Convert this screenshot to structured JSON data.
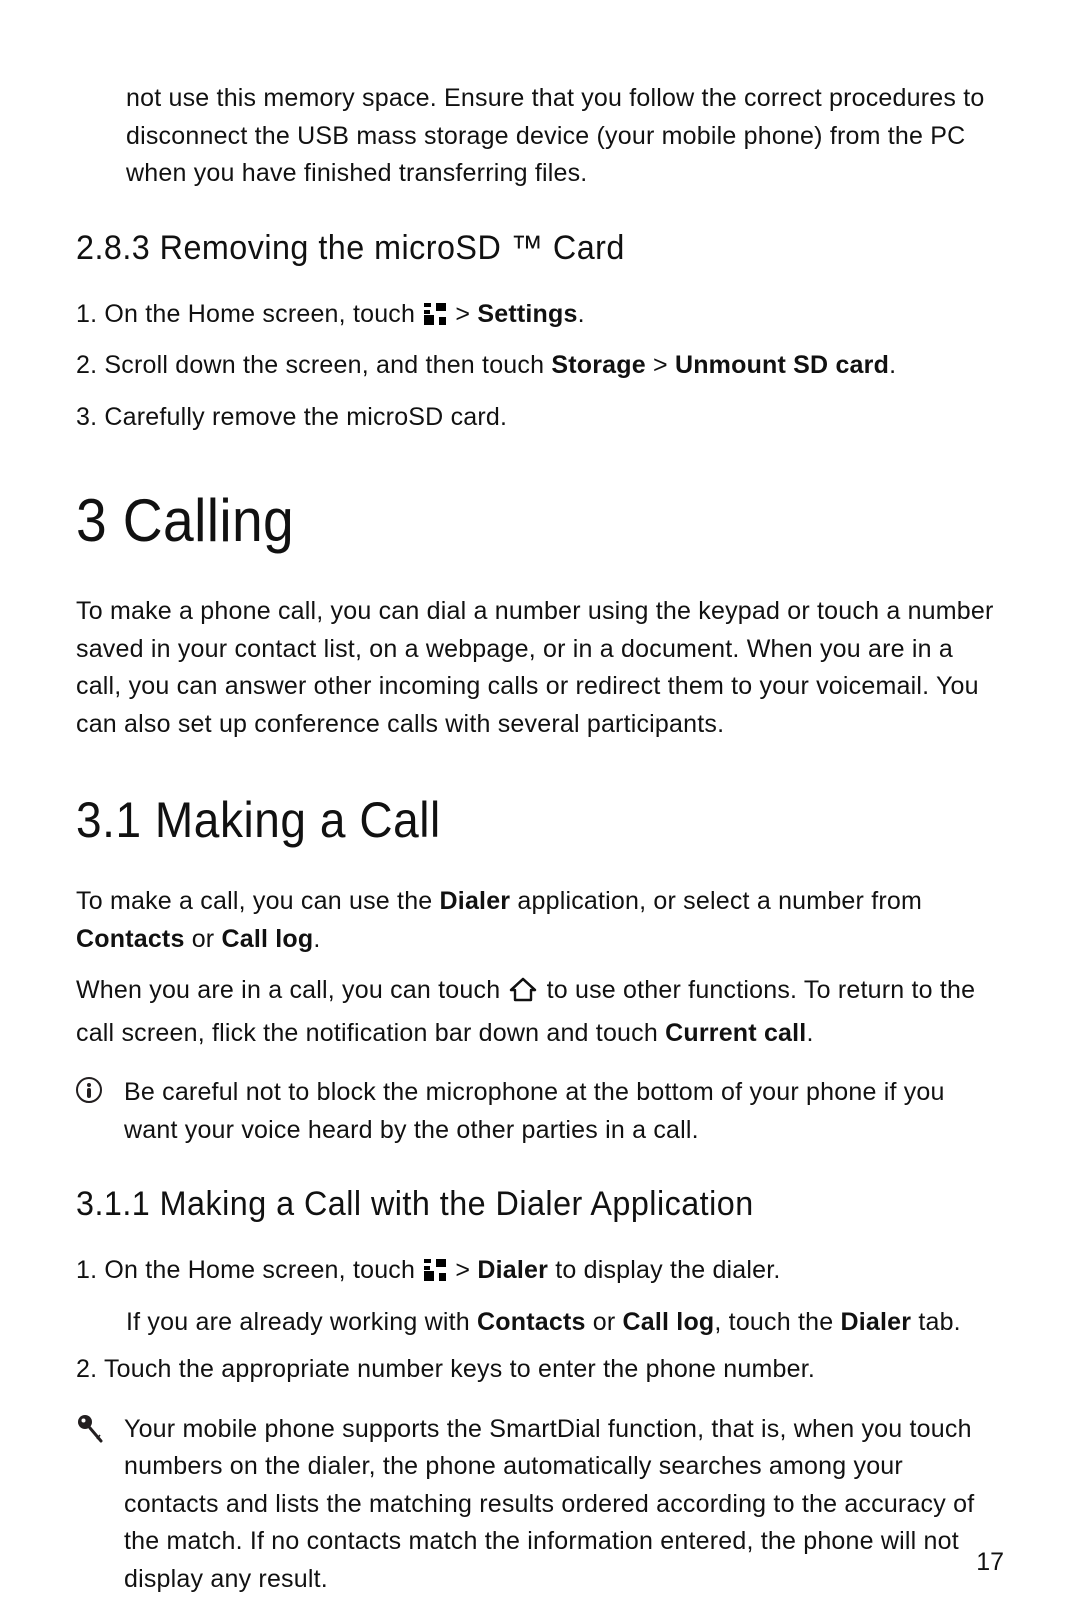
{
  "intro_para": "not use this memory space. Ensure that you follow the correct procedures to disconnect the USB mass storage device (your mobile phone) from the PC when you have finished transferring files.",
  "h3_283": "2.8.3  Removing the microSD ™ Card",
  "s_283_li1_a": "1. On the Home screen, touch ",
  "s_283_li1_b": "  > ",
  "bold_settings": "Settings",
  "s_283_li1_c": ".",
  "s_283_li2_a": "2. Scroll down the screen, and then touch ",
  "bold_storage": "Storage",
  "s_283_li2_b": " > ",
  "bold_unmount": "Unmount SD card",
  "s_283_li2_c": ".",
  "s_283_li3": "3. Carefully remove the microSD card.",
  "h1_3": "3  Calling",
  "p_3_intro": "To make a phone call, you can dial a number using the keypad or touch a number saved in your contact list, on a webpage, or in a document. When you are in a call, you can answer other incoming calls or redirect them to your voicemail. You can also set up conference calls with several participants.",
  "h2_31": "3.1  Making a Call",
  "p_31_1a": "To make a call, you can use the ",
  "bold_dialer": "Dialer",
  "p_31_1b": " application, or select a number from ",
  "bold_contacts": "Contacts",
  "p_31_1c": " or ",
  "bold_calllog": "Call log",
  "p_31_1d": ".",
  "p_31_2a": "When you are in a call, you can touch ",
  "p_31_2b": " to use other functions. To return to the call screen, flick the notification bar down and touch ",
  "bold_currentcall": "Current call",
  "p_31_2c": ".",
  "note1": "Be careful not to block the microphone at the bottom of your phone if you want your voice heard by the other parties in a call.",
  "h3_311": "3.1.1  Making a Call with the Dialer Application",
  "s_311_li1_a": "1. On the Home screen, touch ",
  "s_311_li1_b": "  > ",
  "s_311_li1_c": " to display the dialer.",
  "s_311_sub_a": "If you are already working with ",
  "s_311_sub_b": " or ",
  "s_311_sub_c": ", touch the ",
  "s_311_sub_d": " tab.",
  "s_311_li2": "2. Touch the appropriate number keys to enter the phone number.",
  "tip1": "Your mobile phone supports the SmartDial function, that is, when you touch numbers on the dialer, the phone automatically searches among your contacts and lists the matching results ordered according to the accuracy of the match. If no contacts match the information entered, the phone will not display any result.",
  "page_num": "17"
}
